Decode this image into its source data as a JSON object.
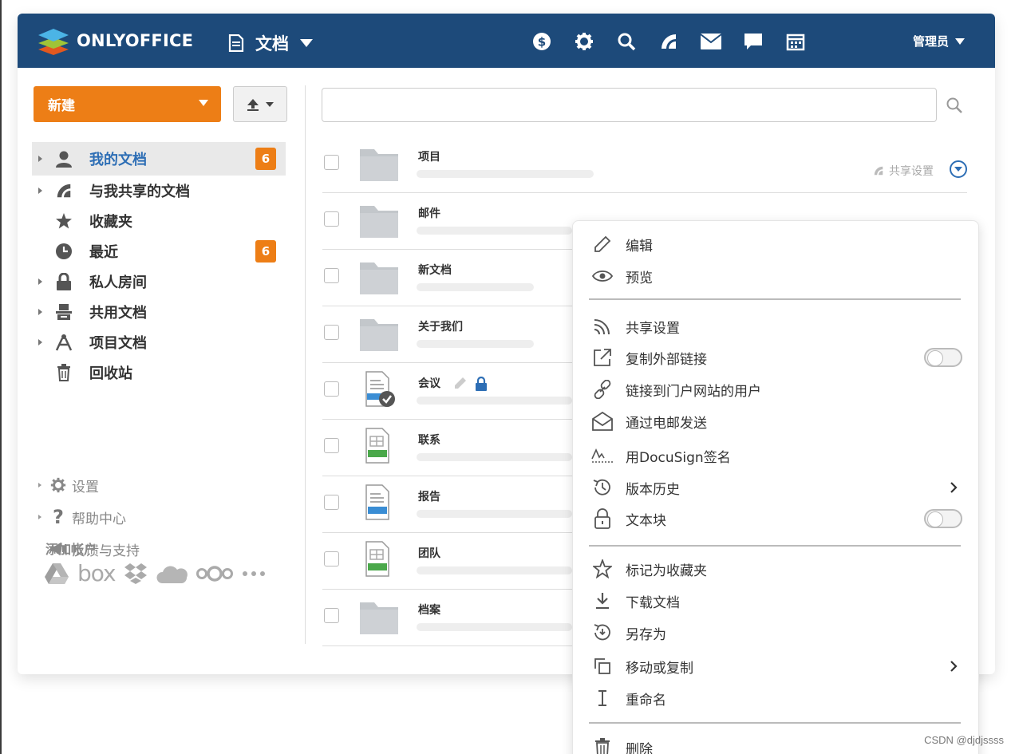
{
  "header": {
    "logo_text": "ONLYOFFICE",
    "module_label": "文档",
    "user_label": "管理员",
    "icons": [
      "dollar-icon",
      "gear-icon",
      "search-icon",
      "feed-icon",
      "mail-icon",
      "chat-icon",
      "calendar-icon"
    ],
    "bg_color": "#1d4a7a"
  },
  "sidebar": {
    "new_button": "新建",
    "tree": [
      {
        "label": "我的文档",
        "icon": "user-icon",
        "badge": "6",
        "active": true,
        "arrow": true
      },
      {
        "label": "与我共享的文档",
        "icon": "share-icon",
        "arrow": true
      },
      {
        "label": "收藏夹",
        "icon": "star-icon"
      },
      {
        "label": "最近",
        "icon": "clock-icon",
        "badge": "6"
      },
      {
        "label": "私人房间",
        "icon": "lock-icon",
        "arrow": true
      },
      {
        "label": "共用文档",
        "icon": "common-docs-icon",
        "arrow": true
      },
      {
        "label": "项目文档",
        "icon": "projects-icon",
        "arrow": true
      },
      {
        "label": "回收站",
        "icon": "trash-icon"
      }
    ],
    "misc": [
      {
        "label": "设置",
        "icon": "gear-icon"
      },
      {
        "label": "帮助中心",
        "icon": "help-icon"
      },
      {
        "label": "反馈与支持",
        "icon": "megaphone-icon"
      }
    ],
    "add_account": "添加帐户",
    "accounts": [
      "google-drive-icon",
      "box-icon",
      "dropbox-icon",
      "onedrive-icon",
      "nextcloud-icon",
      "more-icon"
    ],
    "accent_color": "#ed7e16"
  },
  "search": {
    "placeholder": ""
  },
  "files": [
    {
      "name": "项目",
      "type": "folder",
      "share_label": "共享设置"
    },
    {
      "name": "邮件",
      "type": "folder"
    },
    {
      "name": "新文档",
      "type": "folder"
    },
    {
      "name": "关于我们",
      "type": "folder"
    },
    {
      "name": "会议",
      "type": "docx-locked"
    },
    {
      "name": "联系",
      "type": "xlsx"
    },
    {
      "name": "报告",
      "type": "docx"
    },
    {
      "name": "团队",
      "type": "xlsx"
    },
    {
      "name": "档案",
      "type": "folder"
    }
  ],
  "context_menu": {
    "edit": "编辑",
    "preview": "预览",
    "share_settings": "共享设置",
    "copy_external_link": "复制外部链接",
    "link_for_portal_users": "链接到门户网站的用户",
    "send_by_email": "通过电邮发送",
    "docusign": "用DocuSign签名",
    "version_history": "版本历史",
    "block_file": "文本块",
    "mark_favorite": "标记为收藏夹",
    "download": "下载文档",
    "save_as": "另存为",
    "move_copy": "移动或复制",
    "rename": "重命名",
    "delete": "删除"
  },
  "watermark": "CSDN @djdjssss"
}
